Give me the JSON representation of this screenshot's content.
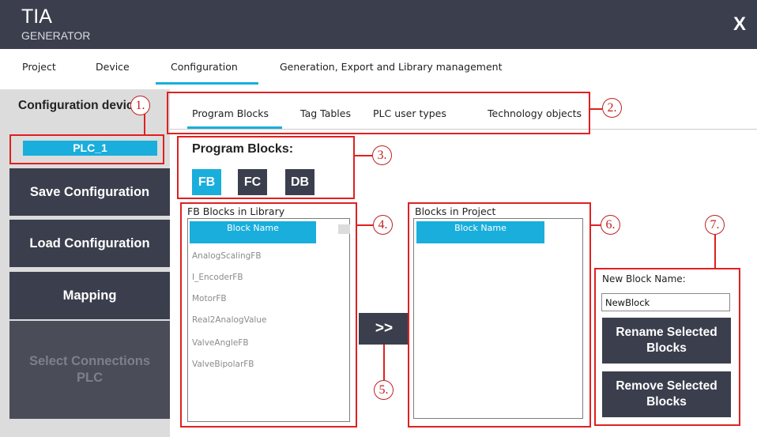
{
  "app": {
    "title": "TIA",
    "subtitle": "GENERATOR",
    "close_label": "X"
  },
  "main_tabs": [
    {
      "label": "Project"
    },
    {
      "label": "Device"
    },
    {
      "label": "Configuration",
      "active": true
    },
    {
      "label": "Generation, Export and Library management"
    }
  ],
  "sidebar": {
    "config_label": "Configuration device:",
    "device": "PLC_1",
    "buttons": [
      {
        "label": "Save Configuration"
      },
      {
        "label": "Load Configuration"
      },
      {
        "label": "Mapping"
      },
      {
        "label": "Select Connections PLC",
        "disabled": true
      }
    ]
  },
  "sub_tabs": [
    {
      "label": "Program Blocks",
      "active": true
    },
    {
      "label": "Tag Tables"
    },
    {
      "label": "PLC user types"
    },
    {
      "label": "Technology objects"
    }
  ],
  "program_blocks": {
    "label": "Program Blocks:",
    "types": [
      "FB",
      "FC",
      "DB"
    ],
    "selected": "FB"
  },
  "library": {
    "label": "FB Blocks in Library",
    "column": "Block Name",
    "items": [
      "AnalogScalingFB",
      "I_EncoderFB",
      "MotorFB",
      "Real2AnalogValue",
      "ValveAngleFB",
      "ValveBipolarFB"
    ]
  },
  "transfer_label": ">>",
  "project": {
    "label": "Blocks in Project",
    "column": "Block Name"
  },
  "rename": {
    "label": "New Block Name:",
    "value": "NewBlock",
    "rename_button": "Rename Selected Blocks",
    "remove_button": "Remove Selected Blocks"
  },
  "annotations": [
    "1.",
    "2.",
    "3.",
    "4.",
    "5.",
    "6.",
    "7."
  ],
  "colors": {
    "accent": "#19aedc",
    "dark": "#3b3f4d",
    "annotation": "#e02020"
  }
}
